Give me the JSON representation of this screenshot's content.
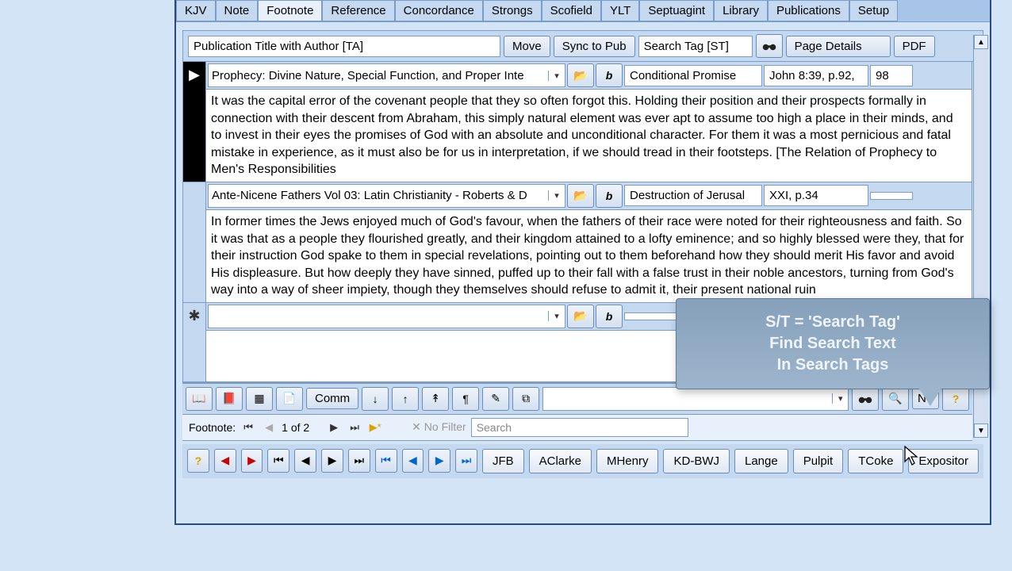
{
  "tabs": [
    "KJV",
    "Note",
    "Footnote",
    "Reference",
    "Concordance",
    "Strongs",
    "Scofield",
    "YLT",
    "Septuagint",
    "Library",
    "Publications",
    "Setup"
  ],
  "active_tab_index": 2,
  "header": {
    "title_field": "Publication Title with Author [TA]",
    "move": "Move",
    "sync": "Sync to Pub",
    "search_tag": "Search Tag [ST]",
    "page_details": "Page Details",
    "pdf": "PDF"
  },
  "entries": [
    {
      "gutter_style": "dark",
      "gutter_glyph": "▶",
      "title": "Prophecy: Divine Nature, Special Function, and Proper Inte",
      "tag": "Conditional Promise",
      "ref": "John 8:39, p.92,",
      "page": "98",
      "body": "It was the capital error of the covenant people that they so often forgot this. Holding their position and their prospects formally in connection with their descent from Abraham, this simply natural element was ever apt to assume too high a place in their minds, and to invest in their eyes the promises of God with an absolute and unconditional character. For them it was a most pernicious and fatal mistake in experience, as it must also be for us in interpretation, if we should tread in their footsteps.  [The Relation of Prophecy to Men's Responsibilities"
    },
    {
      "gutter_style": "light",
      "gutter_glyph": "",
      "title": "Ante-Nicene Fathers Vol 03: Latin Christianity - Roberts & D",
      "tag": "Destruction of Jerusal",
      "ref": "XXI, p.34",
      "page": "",
      "body": "In former times the Jews enjoyed much of God's favour, when the fathers of their race were noted for their righteousness and faith. So it was that as a people they flourished greatly, and their kingdom attained to a lofty eminence; and so highly blessed were they, that for their instruction God spake to them in special revelations, pointing out to them beforehand how they should merit His favor and avoid His displeasure. But how deeply they have sinned, puffed up to their fall with a false trust in their noble ancestors, turning from God's way into a way of sheer impiety, though they themselves should refuse to admit it, their present national ruin"
    },
    {
      "gutter_style": "light",
      "gutter_glyph": "✱",
      "title": "",
      "tag": "",
      "ref": "",
      "page": "",
      "body": ""
    }
  ],
  "bottom_toolbar": {
    "comm": "Comm",
    "nt": "NT"
  },
  "record_nav": {
    "label": "Footnote:",
    "position": "1 of 2",
    "filter": "No Filter",
    "search_ph": "Search"
  },
  "commentaries": [
    "JFB",
    "AClarke",
    "MHenry",
    "KD-BWJ",
    "Lange",
    "Pulpit",
    "TCoke",
    "Expositor"
  ],
  "tooltip": {
    "line1": "S/T = 'Search Tag'",
    "line2": "Find Search Text",
    "line3": "In Search Tags"
  }
}
